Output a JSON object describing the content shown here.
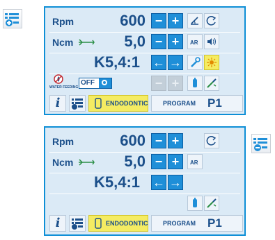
{
  "panel_top": {
    "speed": {
      "label": "Rpm",
      "value": "600"
    },
    "torque": {
      "label": "Ncm",
      "value": "5,0"
    },
    "ratio": "K5,4:1",
    "water_feeding": {
      "label": "WATER FEEDING",
      "state": "OFF"
    },
    "mode_button": "ENDODONTIC",
    "program": {
      "label": "PROGRAM",
      "number": "P1"
    }
  },
  "panel_bottom": {
    "speed": {
      "label": "Rpm",
      "value": "600"
    },
    "torque": {
      "label": "Ncm",
      "value": "5,0"
    },
    "ratio": "K5,4:1",
    "mode_button": "ENDODONTIC",
    "program": {
      "label": "PROGRAM",
      "number": "P1"
    }
  },
  "icons": {
    "expand": "list-plus-icon",
    "collapse": "list-minus-icon",
    "minus": "−",
    "plus": "+",
    "left_arrow": "←",
    "right_arrow": "→",
    "info": "i"
  },
  "colors": {
    "accent": "#1f8fd8",
    "panel_bg": "#dbeaf6",
    "highlight": "#f5ec62",
    "text": "#1b4f8a"
  }
}
